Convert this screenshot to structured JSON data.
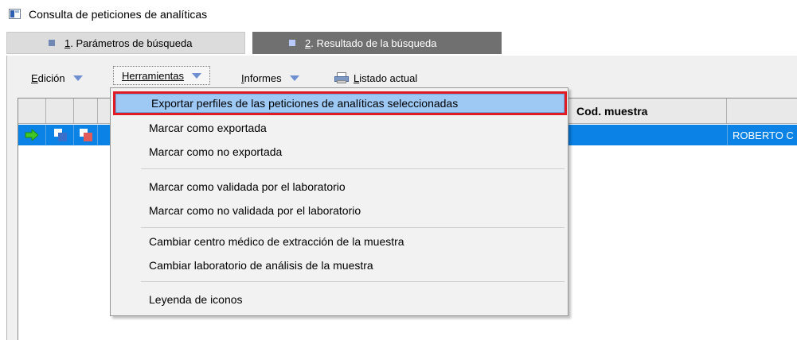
{
  "window": {
    "title": "Consulta de peticiones de analíticas",
    "icon": "app-window-icon"
  },
  "tabs": [
    {
      "number": "1",
      "label": ". Parámetros de búsqueda",
      "selected": false
    },
    {
      "number": "2",
      "label": ". Resultado de la búsqueda",
      "selected": true
    }
  ],
  "toolbar": {
    "edicion": {
      "accel": "E",
      "rest": "dición"
    },
    "herramientas": {
      "accel": "H",
      "rest": "erramientas"
    },
    "informes": {
      "accel": "I",
      "rest": "nformes"
    },
    "listado": {
      "accel": "L",
      "rest": "istado actual",
      "icon": "printer-icon"
    }
  },
  "grid": {
    "columns": [
      "",
      "",
      "",
      "Cod. muestra",
      ""
    ],
    "rows": [
      {
        "icons": [
          "arrow-right-icon",
          "copy-blue-icon",
          "copy-red-icon"
        ],
        "last_cell": "ROBERTO C"
      }
    ]
  },
  "menu": {
    "items": [
      "Exportar perfiles de las peticiones de analíticas seleccionadas",
      "Marcar como exportada",
      "Marcar como no exportada",
      "Marcar como validada por el laboratorio",
      "Marcar como no validada por el laboratorio",
      "Cambiar centro médico de extracción de la muestra",
      "Cambiar laboratorio de análisis de la muestra",
      "Leyenda de iconos"
    ],
    "highlighted_index": 0
  },
  "colors": {
    "selection": "#0a82e6",
    "highlight": "#9ec9f5",
    "annotation": "#e11b24",
    "active_tab": "#707070"
  }
}
